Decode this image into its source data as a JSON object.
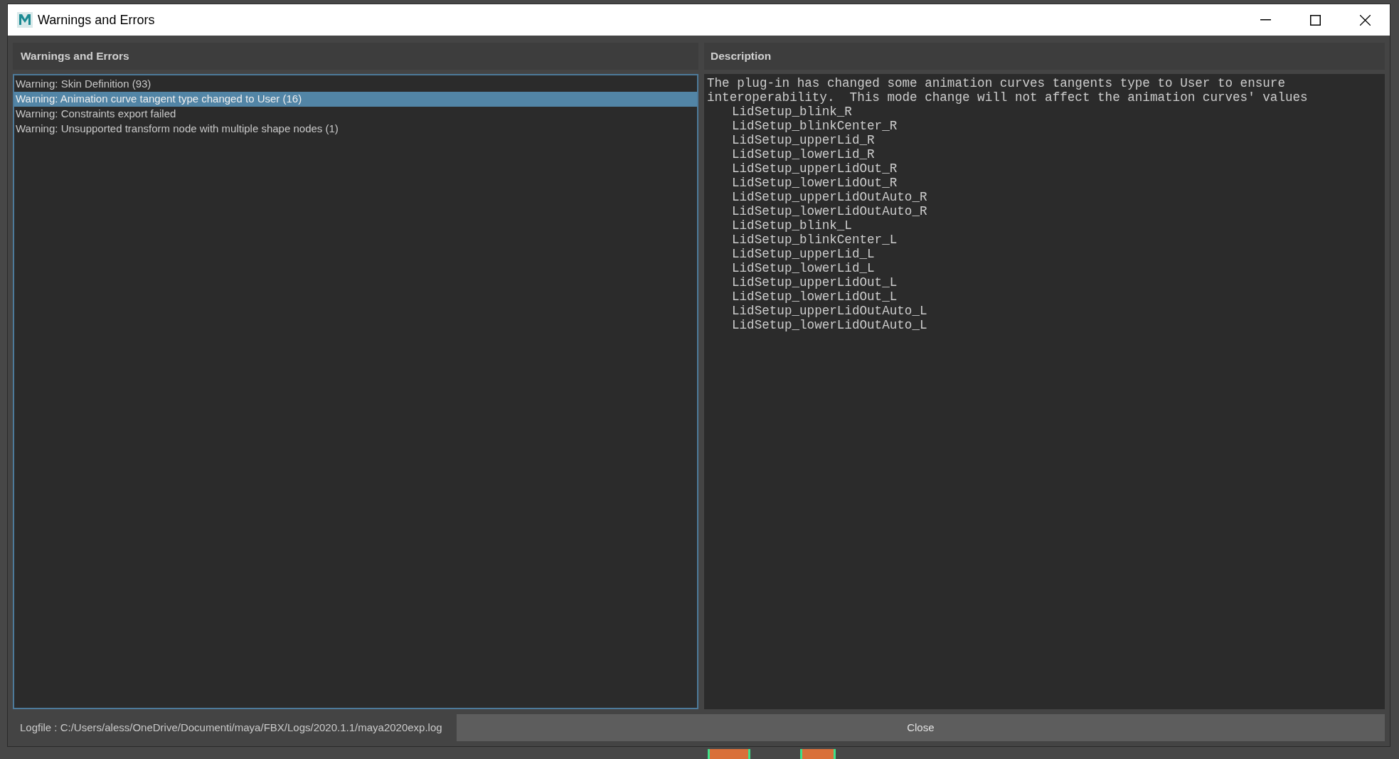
{
  "window": {
    "title": "Warnings and Errors"
  },
  "warnings_panel": {
    "title": "Warnings and Errors",
    "items": [
      {
        "label": "Warning: Skin Definition (93)",
        "selected": false
      },
      {
        "label": "Warning: Animation curve tangent type changed to User (16)",
        "selected": true
      },
      {
        "label": "Warning: Constraints export failed",
        "selected": false
      },
      {
        "label": "Warning: Unsupported transform node with multiple shape nodes (1)",
        "selected": false
      }
    ]
  },
  "description_panel": {
    "title": "Description",
    "text": "The plug-in has changed some animation curves tangents type to User to ensure interoperability.  This mode change will not affect the animation curves' values",
    "items": [
      "LidSetup_blink_R",
      "LidSetup_blinkCenter_R",
      "LidSetup_upperLid_R",
      "LidSetup_lowerLid_R",
      "LidSetup_upperLidOut_R",
      "LidSetup_lowerLidOut_R",
      "LidSetup_upperLidOutAuto_R",
      "LidSetup_lowerLidOutAuto_R",
      "LidSetup_blink_L",
      "LidSetup_blinkCenter_L",
      "LidSetup_upperLid_L",
      "LidSetup_lowerLid_L",
      "LidSetup_upperLidOut_L",
      "LidSetup_lowerLidOut_L",
      "LidSetup_upperLidOutAuto_L",
      "LidSetup_lowerLidOutAuto_L"
    ]
  },
  "footer": {
    "logfile": "Logfile : C:/Users/aless/OneDrive/Documenti/maya/FBX/Logs/2020.1.1/maya2020exp.log",
    "button": "Close"
  }
}
